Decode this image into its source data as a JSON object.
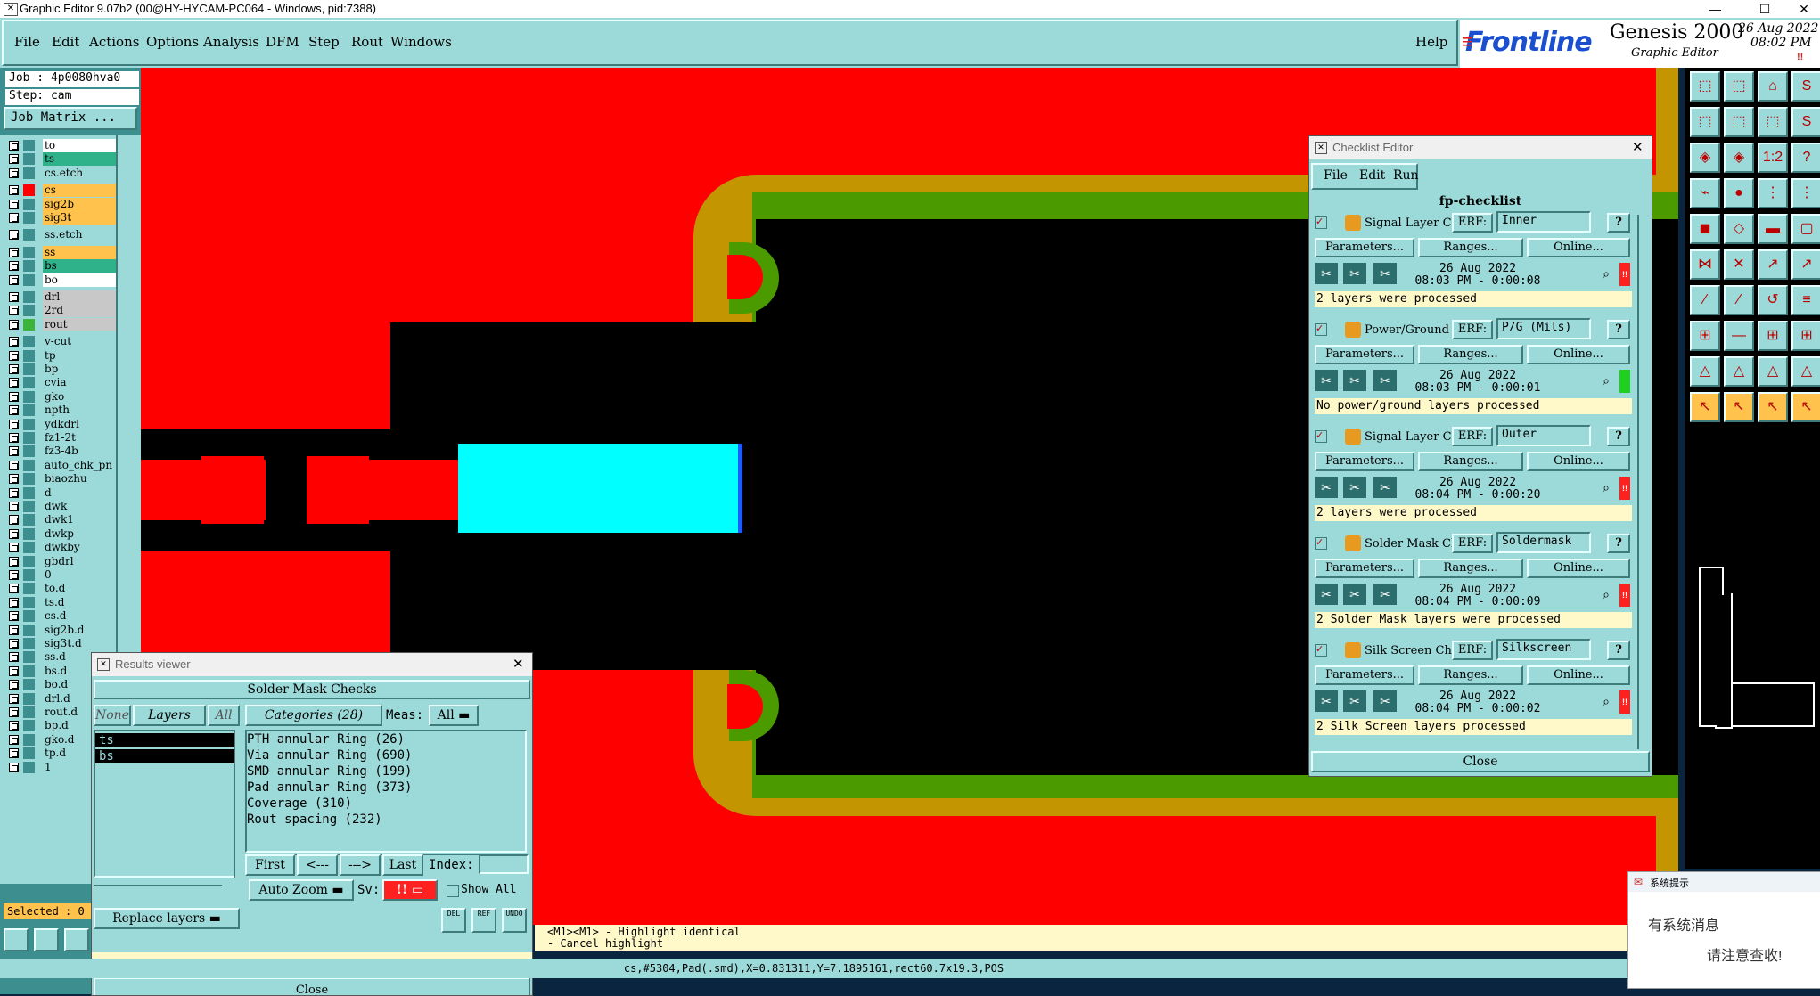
{
  "window": {
    "title": "Graphic Editor 9.07b2 (00@HY-HYCAM-PC064 - Windows, pid:7388)",
    "minimize": "—",
    "maximize": "☐",
    "close": "✕"
  },
  "menu": {
    "items": [
      "File",
      "Edit",
      "Actions",
      "Options",
      "Analysis",
      "DFM",
      "Step",
      "Rout",
      "Windows"
    ],
    "help": "Help"
  },
  "logo": {
    "brand": "Frontline",
    "product": "Genesis 2000",
    "subtitle": "Graphic Editor",
    "date": "26 Aug 2022",
    "time": "08:02 PM",
    "alert": "!!"
  },
  "job": {
    "job_label": "Job : 4p0080hva0",
    "step_label": "Step: cam",
    "matrix_button": "Job Matrix ...",
    "selected": "Selected : 0"
  },
  "layers": [
    {
      "name": "to",
      "color": "#ffffff"
    },
    {
      "name": "ts",
      "color": "#2fb28a"
    },
    {
      "name": "cs.etch",
      "color": "#9cd9d9"
    },
    {
      "name": "cs",
      "color": "#ffc34d",
      "swatch": "#ff0000"
    },
    {
      "name": "sig2b",
      "color": "#ffc34d"
    },
    {
      "name": "sig3t",
      "color": "#ffc34d"
    },
    {
      "name": "ss.etch",
      "color": "#9cd9d9"
    },
    {
      "name": "ss",
      "color": "#ffc34d"
    },
    {
      "name": "bs",
      "color": "#2fb28a"
    },
    {
      "name": "bo",
      "color": "#ffffff"
    },
    {
      "name": "drl",
      "color": "#c8c8c8"
    },
    {
      "name": "2rd",
      "color": "#c8c8c8"
    },
    {
      "name": "rout",
      "color": "#c8c8c8",
      "swatch": "#3cb43c"
    },
    {
      "name": "v-cut",
      "color": "#9cd9d9"
    },
    {
      "name": "tp",
      "color": "#9cd9d9"
    },
    {
      "name": "bp",
      "color": "#9cd9d9"
    },
    {
      "name": "cvia",
      "color": "#9cd9d9"
    },
    {
      "name": "gko",
      "color": "#9cd9d9"
    },
    {
      "name": "npth",
      "color": "#9cd9d9"
    },
    {
      "name": "ydkdrl",
      "color": "#9cd9d9"
    },
    {
      "name": "fz1-2t",
      "color": "#9cd9d9"
    },
    {
      "name": "fz3-4b",
      "color": "#9cd9d9"
    },
    {
      "name": "auto_chk_pn",
      "color": "#9cd9d9"
    },
    {
      "name": "biaozhu",
      "color": "#9cd9d9"
    },
    {
      "name": "d",
      "color": "#9cd9d9"
    },
    {
      "name": "dwk",
      "color": "#9cd9d9"
    },
    {
      "name": "dwk1",
      "color": "#9cd9d9"
    },
    {
      "name": "dwkp",
      "color": "#9cd9d9"
    },
    {
      "name": "dwkby",
      "color": "#9cd9d9"
    },
    {
      "name": "gbdrl",
      "color": "#9cd9d9"
    },
    {
      "name": "0",
      "color": "#9cd9d9"
    },
    {
      "name": "to.d",
      "color": "#9cd9d9"
    },
    {
      "name": "ts.d",
      "color": "#9cd9d9"
    },
    {
      "name": "cs.d",
      "color": "#9cd9d9"
    },
    {
      "name": "sig2b.d",
      "color": "#9cd9d9"
    },
    {
      "name": "sig3t.d",
      "color": "#9cd9d9"
    },
    {
      "name": "ss.d",
      "color": "#9cd9d9"
    },
    {
      "name": "bs.d",
      "color": "#9cd9d9"
    },
    {
      "name": "bo.d",
      "color": "#9cd9d9"
    },
    {
      "name": "drl.d",
      "color": "#9cd9d9"
    },
    {
      "name": "rout.d",
      "color": "#9cd9d9"
    },
    {
      "name": "bp.d",
      "color": "#9cd9d9"
    },
    {
      "name": "gko.d",
      "color": "#9cd9d9"
    },
    {
      "name": "tp.d",
      "color": "#9cd9d9"
    },
    {
      "name": "1",
      "color": "#9cd9d9"
    }
  ],
  "checklist": {
    "title": "Checklist Editor",
    "menu": [
      "File",
      "Edit",
      "Run"
    ],
    "name": "fp-checklist",
    "erf_label": "ERF:",
    "help": "?",
    "buttons": {
      "parameters": "Parameters...",
      "ranges": "Ranges...",
      "online": "Online..."
    },
    "close": "Close",
    "entries": [
      {
        "name": "Signal Layer Ch",
        "erf": "Inner",
        "date": "26 Aug 2022",
        "time": "08:03 PM - 0:00:08",
        "status": "!!",
        "status_color": "#ff2020",
        "message": "2 layers were processed"
      },
      {
        "name": "Power/Ground C",
        "erf": "P/G (Mils)",
        "date": "26 Aug 2022",
        "time": "08:03 PM - 0:00:01",
        "status": "",
        "status_color": "#20d020",
        "message": "No power/ground layers processed"
      },
      {
        "name": "Signal Layer Ch",
        "erf": "Outer",
        "date": "26 Aug 2022",
        "time": "08:04 PM - 0:00:20",
        "status": "!!",
        "status_color": "#ff2020",
        "message": "2 layers were processed"
      },
      {
        "name": "Solder Mask Ch",
        "erf": "Soldermask",
        "date": "26 Aug 2022",
        "time": "08:04 PM - 0:00:09",
        "status": "!!",
        "status_color": "#ff2020",
        "message": "2 Solder Mask layers were processed"
      },
      {
        "name": "Silk Screen Che",
        "erf": "Silkscreen",
        "date": "26 Aug 2022",
        "time": "08:04 PM - 0:00:02",
        "status": "!!",
        "status_color": "#ff2020",
        "message": "2 Silk Screen layers processed"
      }
    ]
  },
  "results": {
    "title": "Results viewer",
    "header": "Solder Mask Checks",
    "none": "None",
    "layers_btn": "Layers",
    "all": "All",
    "categories_btn": "Categories (28)",
    "meas_label": "Meas:",
    "meas_value": "All",
    "layer_list": [
      "ts",
      "bs"
    ],
    "categories": [
      "PTH annular Ring (26)",
      "Via annular Ring (690)",
      "SMD annular Ring (199)",
      "Pad annular Ring (373)",
      "Coverage (310)",
      "Rout spacing (232)"
    ],
    "nav": {
      "first": "First",
      "prev": "<---",
      "next": "--->",
      "last": "Last",
      "index": "Index:"
    },
    "zoom": "Auto Zoom",
    "sv_label": "Sv:",
    "sv_value": "!!",
    "show_all": "Show All",
    "replace": "Replace layers",
    "del": "DEL",
    "ref": "REF",
    "undo": "UNDO",
    "close": "Close"
  },
  "hint": {
    "line1": "<M1><M1> - Highlight identical",
    "line2": "- Cancel highlight"
  },
  "status": "cs,#5304,Pad(.smd),X=0.831311,Y=7.1895161,rect60.7x19.3,POS",
  "system_message": {
    "title": "系统提示",
    "line1": "有系统消息",
    "line2": "请注意查收!"
  },
  "colors": {
    "copper": "#ff0000",
    "mask": "#c39500",
    "outline": "#4a9a00",
    "highlight": "#00ffff",
    "panel": "#9cd9d9"
  }
}
